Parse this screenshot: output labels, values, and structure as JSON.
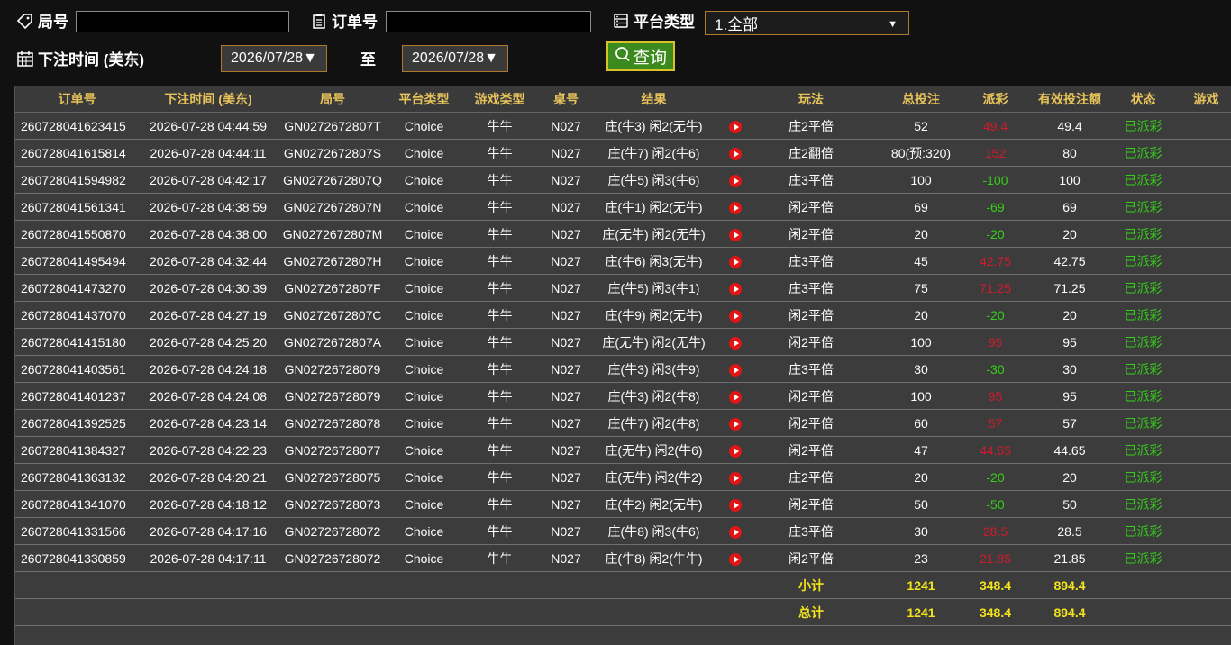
{
  "filters": {
    "round_label": "局号",
    "round_value": "",
    "order_label": "订单号",
    "order_value": "",
    "platform_label": "平台类型",
    "platform_selected": "1.全部",
    "time_label": "下注时间 (美东)",
    "date_from": "2026/07/28▼",
    "to_label": "至",
    "date_to": "2026/07/28▼",
    "query_label": "查询"
  },
  "table": {
    "headers": [
      "订单号",
      "下注时间 (美东)",
      "局号",
      "平台类型",
      "游戏类型",
      "桌号",
      "结果",
      "",
      "玩法",
      "总投注",
      "派彩",
      "有效投注额",
      "状态",
      "游戏"
    ],
    "rows": [
      {
        "order": "260728041623415",
        "time": "2026-07-28 04:44:59",
        "round": "GN0272672807T",
        "platform": "Choice",
        "game": "牛牛",
        "table": "N027",
        "result": "庄(牛3) 闲2(无牛)",
        "play": "庄2平倍",
        "bet": "52",
        "payout": "49.4",
        "payout_sign": "pos",
        "valid": "49.4",
        "status": "已派彩"
      },
      {
        "order": "260728041615814",
        "time": "2026-07-28 04:44:11",
        "round": "GN0272672807S",
        "platform": "Choice",
        "game": "牛牛",
        "table": "N027",
        "result": "庄(牛7) 闲2(牛6)",
        "play": "庄2翻倍",
        "bet": "80(预:320)",
        "payout": "152",
        "payout_sign": "pos",
        "valid": "80",
        "status": "已派彩"
      },
      {
        "order": "260728041594982",
        "time": "2026-07-28 04:42:17",
        "round": "GN0272672807Q",
        "platform": "Choice",
        "game": "牛牛",
        "table": "N027",
        "result": "庄(牛5) 闲3(牛6)",
        "play": "庄3平倍",
        "bet": "100",
        "payout": "-100",
        "payout_sign": "neg",
        "valid": "100",
        "status": "已派彩"
      },
      {
        "order": "260728041561341",
        "time": "2026-07-28 04:38:59",
        "round": "GN0272672807N",
        "platform": "Choice",
        "game": "牛牛",
        "table": "N027",
        "result": "庄(牛1) 闲2(无牛)",
        "play": "闲2平倍",
        "bet": "69",
        "payout": "-69",
        "payout_sign": "neg",
        "valid": "69",
        "status": "已派彩"
      },
      {
        "order": "260728041550870",
        "time": "2026-07-28 04:38:00",
        "round": "GN0272672807M",
        "platform": "Choice",
        "game": "牛牛",
        "table": "N027",
        "result": "庄(无牛) 闲2(无牛)",
        "play": "闲2平倍",
        "bet": "20",
        "payout": "-20",
        "payout_sign": "neg",
        "valid": "20",
        "status": "已派彩"
      },
      {
        "order": "260728041495494",
        "time": "2026-07-28 04:32:44",
        "round": "GN0272672807H",
        "platform": "Choice",
        "game": "牛牛",
        "table": "N027",
        "result": "庄(牛6) 闲3(无牛)",
        "play": "庄3平倍",
        "bet": "45",
        "payout": "42.75",
        "payout_sign": "pos",
        "valid": "42.75",
        "status": "已派彩"
      },
      {
        "order": "260728041473270",
        "time": "2026-07-28 04:30:39",
        "round": "GN0272672807F",
        "platform": "Choice",
        "game": "牛牛",
        "table": "N027",
        "result": "庄(牛5) 闲3(牛1)",
        "play": "庄3平倍",
        "bet": "75",
        "payout": "71.25",
        "payout_sign": "pos",
        "valid": "71.25",
        "status": "已派彩"
      },
      {
        "order": "260728041437070",
        "time": "2026-07-28 04:27:19",
        "round": "GN0272672807C",
        "platform": "Choice",
        "game": "牛牛",
        "table": "N027",
        "result": "庄(牛9) 闲2(无牛)",
        "play": "闲2平倍",
        "bet": "20",
        "payout": "-20",
        "payout_sign": "neg",
        "valid": "20",
        "status": "已派彩"
      },
      {
        "order": "260728041415180",
        "time": "2026-07-28 04:25:20",
        "round": "GN0272672807A",
        "platform": "Choice",
        "game": "牛牛",
        "table": "N027",
        "result": "庄(无牛) 闲2(无牛)",
        "play": "闲2平倍",
        "bet": "100",
        "payout": "95",
        "payout_sign": "pos",
        "valid": "95",
        "status": "已派彩"
      },
      {
        "order": "260728041403561",
        "time": "2026-07-28 04:24:18",
        "round": "GN02726728079",
        "platform": "Choice",
        "game": "牛牛",
        "table": "N027",
        "result": "庄(牛3) 闲3(牛9)",
        "play": "庄3平倍",
        "bet": "30",
        "payout": "-30",
        "payout_sign": "neg",
        "valid": "30",
        "status": "已派彩"
      },
      {
        "order": "260728041401237",
        "time": "2026-07-28 04:24:08",
        "round": "GN02726728079",
        "platform": "Choice",
        "game": "牛牛",
        "table": "N027",
        "result": "庄(牛3) 闲2(牛8)",
        "play": "闲2平倍",
        "bet": "100",
        "payout": "95",
        "payout_sign": "pos",
        "valid": "95",
        "status": "已派彩"
      },
      {
        "order": "260728041392525",
        "time": "2026-07-28 04:23:14",
        "round": "GN02726728078",
        "platform": "Choice",
        "game": "牛牛",
        "table": "N027",
        "result": "庄(牛7) 闲2(牛8)",
        "play": "闲2平倍",
        "bet": "60",
        "payout": "57",
        "payout_sign": "pos",
        "valid": "57",
        "status": "已派彩"
      },
      {
        "order": "260728041384327",
        "time": "2026-07-28 04:22:23",
        "round": "GN02726728077",
        "platform": "Choice",
        "game": "牛牛",
        "table": "N027",
        "result": "庄(无牛) 闲2(牛6)",
        "play": "闲2平倍",
        "bet": "47",
        "payout": "44.65",
        "payout_sign": "pos",
        "valid": "44.65",
        "status": "已派彩"
      },
      {
        "order": "260728041363132",
        "time": "2026-07-28 04:20:21",
        "round": "GN02726728075",
        "platform": "Choice",
        "game": "牛牛",
        "table": "N027",
        "result": "庄(无牛) 闲2(牛2)",
        "play": "庄2平倍",
        "bet": "20",
        "payout": "-20",
        "payout_sign": "neg",
        "valid": "20",
        "status": "已派彩"
      },
      {
        "order": "260728041341070",
        "time": "2026-07-28 04:18:12",
        "round": "GN02726728073",
        "platform": "Choice",
        "game": "牛牛",
        "table": "N027",
        "result": "庄(牛2) 闲2(无牛)",
        "play": "闲2平倍",
        "bet": "50",
        "payout": "-50",
        "payout_sign": "neg",
        "valid": "50",
        "status": "已派彩"
      },
      {
        "order": "260728041331566",
        "time": "2026-07-28 04:17:16",
        "round": "GN02726728072",
        "platform": "Choice",
        "game": "牛牛",
        "table": "N027",
        "result": "庄(牛8) 闲3(牛6)",
        "play": "庄3平倍",
        "bet": "30",
        "payout": "28.5",
        "payout_sign": "pos",
        "valid": "28.5",
        "status": "已派彩"
      },
      {
        "order": "260728041330859",
        "time": "2026-07-28 04:17:11",
        "round": "GN02726728072",
        "platform": "Choice",
        "game": "牛牛",
        "table": "N027",
        "result": "庄(牛8) 闲2(牛牛)",
        "play": "闲2平倍",
        "bet": "23",
        "payout": "21.85",
        "payout_sign": "pos",
        "valid": "21.85",
        "status": "已派彩"
      }
    ],
    "subtotal": {
      "label": "小计",
      "bet": "1241",
      "payout": "348.4",
      "valid": "894.4"
    },
    "total": {
      "label": "总计",
      "bet": "1241",
      "payout": "348.4",
      "valid": "894.4"
    }
  },
  "colors": {
    "header_text": "#e7c35a",
    "negative": "#34d018",
    "positive": "#d21a2c",
    "status": "#34d018",
    "sum_text": "#f2e31b",
    "play_icon": "#e01616"
  }
}
